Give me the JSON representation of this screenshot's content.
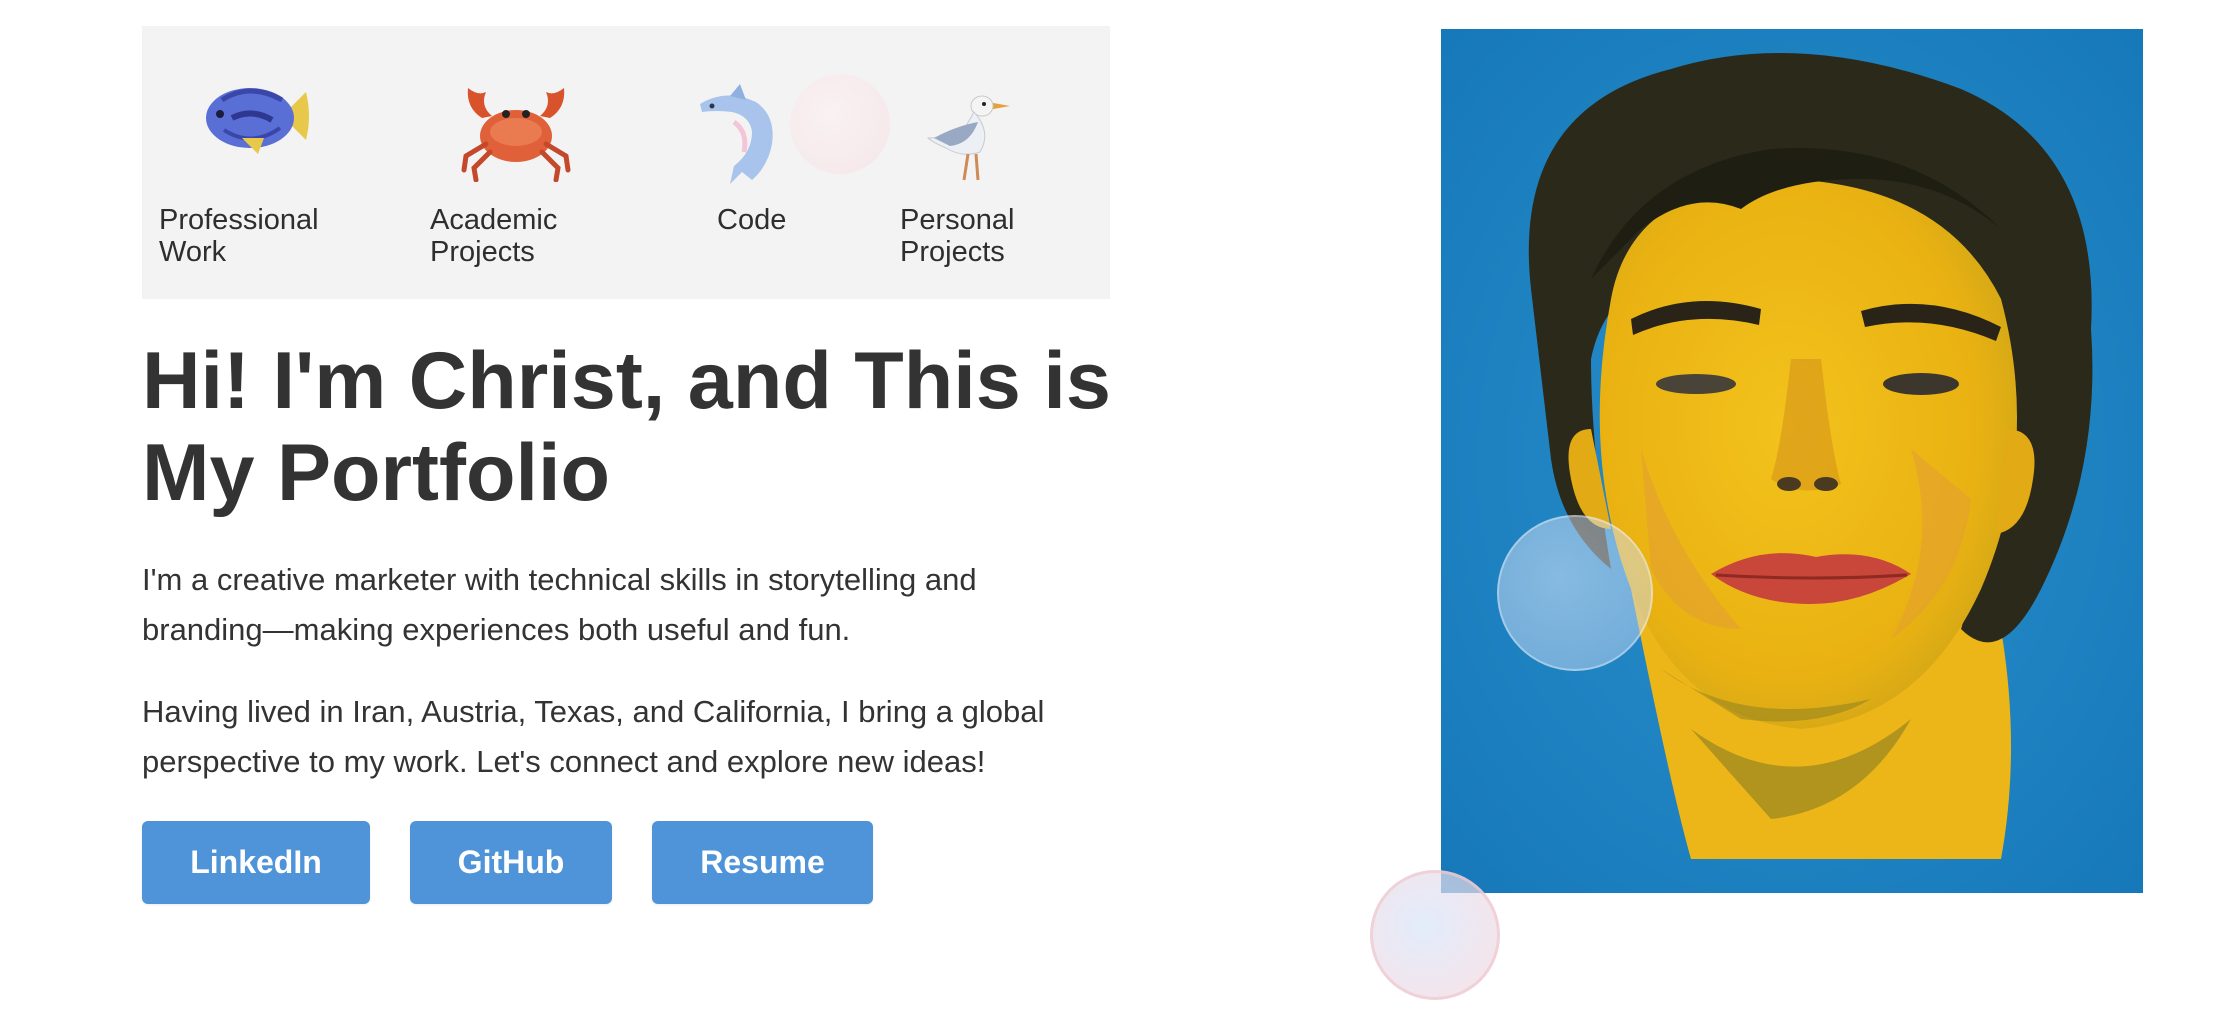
{
  "nav": {
    "items": [
      {
        "label": "Professional\nWork",
        "icon": "fish-icon"
      },
      {
        "label": "Academic\nProjects",
        "icon": "crab-icon"
      },
      {
        "label": "Code",
        "icon": "dolphin-icon"
      },
      {
        "label": "Personal\nProjects",
        "icon": "seagull-icon"
      }
    ]
  },
  "hero": {
    "title": "Hi! I'm Christ, and This is My Portfolio",
    "intro": "I'm a creative marketer with technical skills in storytelling and branding—making experiences both useful and fun.",
    "bio": "Having lived in Iran, Austria, Texas, and California, I bring a global perspective to my work. Let's connect and explore new ideas!"
  },
  "buttons": {
    "linkedin": "LinkedIn",
    "github": "GitHub",
    "resume": "Resume"
  },
  "colors": {
    "button_bg": "#4f94d8",
    "nav_bg": "#f3f3f4",
    "portrait_bg": "#1f86c6"
  }
}
